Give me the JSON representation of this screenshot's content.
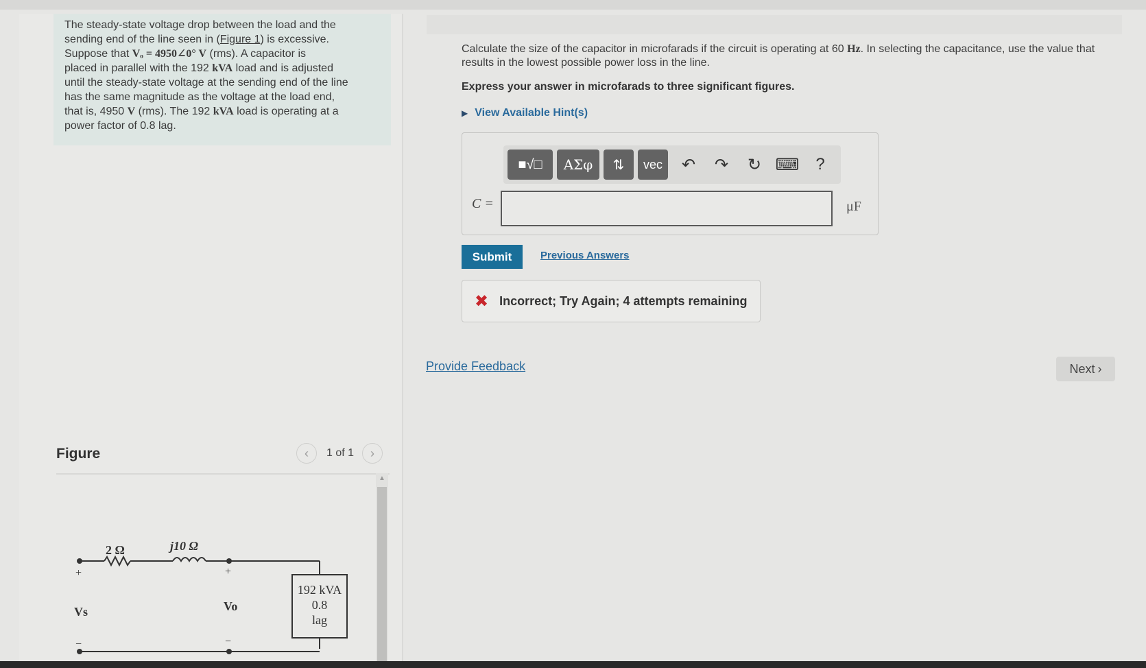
{
  "intro": {
    "line1": "The steady-state voltage drop between the load and the",
    "line2_pre": "sending end of the line seen in (",
    "figure_link": "Figure 1",
    "line2_post": ") is excessive.",
    "line3_pre": "Suppose that ",
    "line3_math": "Vₒ = 4950∠0° V",
    "line3_post": " (rms). A capacitor is",
    "line4_pre": "placed in parallel with the 192 ",
    "line4_math": "kVA",
    "line4_post": " load and is adjusted",
    "line5": "until the steady-state voltage at the sending end of the line",
    "line6": "has the same magnitude as the voltage at the load end,",
    "line7_pre": "that is, 4950 ",
    "line7_math": "V",
    "line7_mid": " (rms). The 192 ",
    "line7_math2": "kVA",
    "line7_post": " load is operating at a",
    "line8": "power factor of 0.8 lag."
  },
  "figure": {
    "title": "Figure",
    "page_count": "1 of 1",
    "prev_icon": "chevron-left-icon",
    "next_icon": "chevron-right-icon"
  },
  "circuit": {
    "resistor_label": "2 Ω",
    "inductor_label": "j10 Ω",
    "source_voltage_label": "Vs",
    "load_voltage_label": "Vo",
    "plus": "+",
    "minus": "−",
    "load_line1": "192 kVA",
    "load_line2": "0.8",
    "load_line3": "lag"
  },
  "question": {
    "text_pre": "Calculate the size of the capacitor in microfarads if the circuit is operating at 60 ",
    "freq_unit": "Hz",
    "text_post": ". In selecting the capacitance, use the value that results in the lowest possible power loss in the line.",
    "instruction": "Express your answer in microfarads to three significant figures.",
    "hints_label": "View Available Hint(s)"
  },
  "answer": {
    "variable": "C =",
    "value": "",
    "unit": "μF",
    "toolbar": {
      "templates_label": "■√□",
      "greek_label": "ΑΣφ",
      "arrows_label": "⇅",
      "vec_label": "vec",
      "undo_icon": "undo-icon",
      "redo_icon": "redo-icon",
      "reset_icon": "reset-icon",
      "keyboard_icon": "keyboard-icon",
      "help_label": "?"
    }
  },
  "actions": {
    "submit_label": "Submit",
    "previous_answers_label": "Previous Answers"
  },
  "feedback": {
    "icon": "x-mark-icon",
    "message": "Incorrect; Try Again; 4 attempts remaining",
    "color": "#c8262c"
  },
  "footer": {
    "provide_feedback_label": "Provide Feedback",
    "next_label": "Next"
  },
  "colors": {
    "accent": "#1a6f99",
    "link": "#2a6a9c",
    "intro_bg": "#dde6e3"
  }
}
